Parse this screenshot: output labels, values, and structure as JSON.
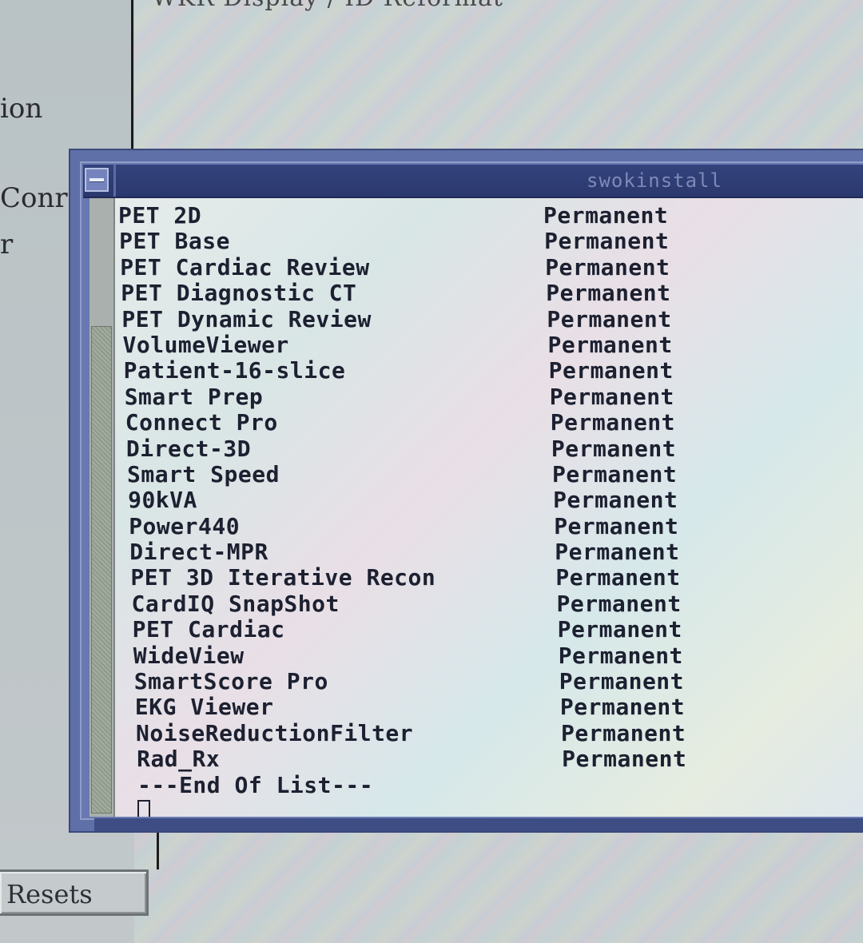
{
  "background": {
    "fragment_top": "WKR Display / ID Reformat",
    "left_fragments": [
      "ion",
      "Conr",
      "r"
    ],
    "resets_label": "Resets"
  },
  "window": {
    "title": "swokinstall",
    "menu_button_icon": "window-menu-icon"
  },
  "licenses": [
    {
      "name": "PET 2D",
      "status": "Permanent"
    },
    {
      "name": "PET Base",
      "status": "Permanent"
    },
    {
      "name": "PET Cardiac Review",
      "status": "Permanent"
    },
    {
      "name": "PET Diagnostic CT",
      "status": "Permanent"
    },
    {
      "name": "PET Dynamic Review",
      "status": "Permanent"
    },
    {
      "name": "VolumeViewer",
      "status": "Permanent"
    },
    {
      "name": "Patient-16-slice",
      "status": "Permanent"
    },
    {
      "name": "Smart Prep",
      "status": "Permanent"
    },
    {
      "name": "Connect Pro",
      "status": "Permanent"
    },
    {
      "name": "Direct-3D",
      "status": "Permanent"
    },
    {
      "name": "Smart Speed",
      "status": "Permanent"
    },
    {
      "name": "90kVA",
      "status": "Permanent"
    },
    {
      "name": "Power440",
      "status": "Permanent"
    },
    {
      "name": "Direct-MPR",
      "status": "Permanent"
    },
    {
      "name": "PET 3D Iterative Recon",
      "status": "Permanent"
    },
    {
      "name": "CardIQ SnapShot",
      "status": "Permanent"
    },
    {
      "name": "PET Cardiac",
      "status": "Permanent"
    },
    {
      "name": "WideView",
      "status": "Permanent"
    },
    {
      "name": "SmartScore Pro",
      "status": "Permanent"
    },
    {
      "name": "EKG Viewer",
      "status": "Permanent"
    },
    {
      "name": "NoiseReductionFilter",
      "status": "Permanent"
    },
    {
      "name": "Rad_Rx",
      "status": "Permanent"
    }
  ],
  "end_of_list": "---End Of List---",
  "colors": {
    "titlebar": "#2a386e",
    "window_frame": "#5f6fa7",
    "text": "#1c2030"
  }
}
